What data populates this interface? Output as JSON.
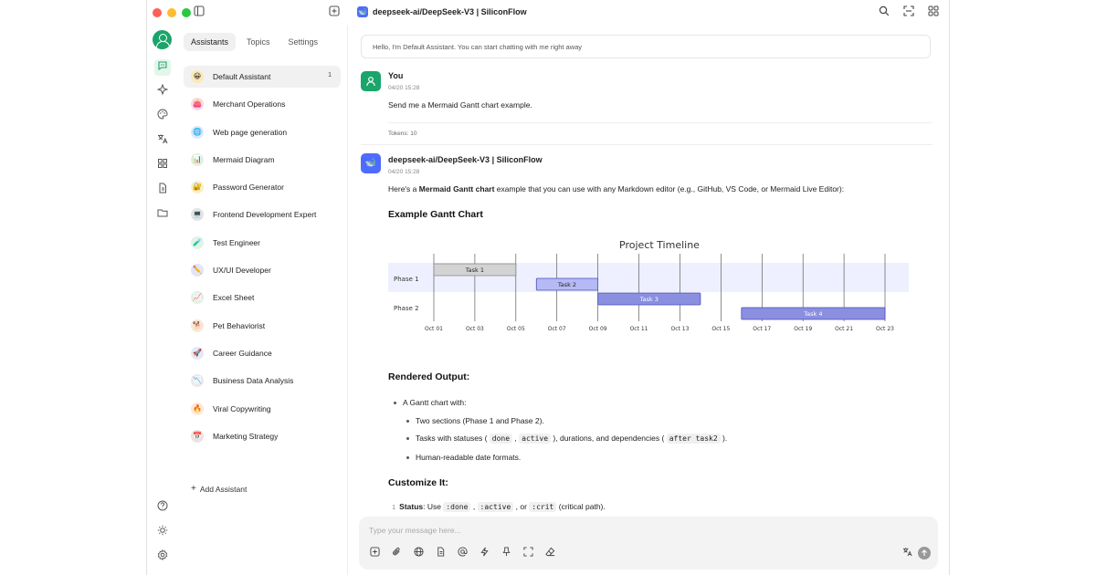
{
  "window": {
    "model_title": "deepseek-ai/DeepSeek-V3 | SiliconFlow"
  },
  "panel": {
    "tabs": [
      "Assistants",
      "Topics",
      "Settings"
    ],
    "assistants": [
      {
        "label": "Default Assistant",
        "emoji": "😀",
        "count": "1",
        "bg": "#fde9b8"
      },
      {
        "label": "Merchant Operations",
        "emoji": "👛",
        "bg": "#fbd7e6"
      },
      {
        "label": "Web page generation",
        "emoji": "🌐",
        "bg": "#dbe9fb"
      },
      {
        "label": "Mermaid Diagram",
        "emoji": "📊",
        "bg": "#e3f3d7"
      },
      {
        "label": "Password Generator",
        "emoji": "🔐",
        "bg": "#fbefc4"
      },
      {
        "label": "Frontend Development Expert",
        "emoji": "💻",
        "bg": "#e4e4e4"
      },
      {
        "label": "Test Engineer",
        "emoji": "🧪",
        "bg": "#e2f4e4"
      },
      {
        "label": "UX/UI Developer",
        "emoji": "✏️",
        "bg": "#e2e4f7"
      },
      {
        "label": "Excel Sheet",
        "emoji": "📈",
        "bg": "#e2f1e3"
      },
      {
        "label": "Pet Behaviorist",
        "emoji": "🐕",
        "bg": "#f8e7d8"
      },
      {
        "label": "Career Guidance",
        "emoji": "🚀",
        "bg": "#e6e8f6"
      },
      {
        "label": "Business Data Analysis",
        "emoji": "📉",
        "bg": "#efe6ee"
      },
      {
        "label": "Viral Copywriting",
        "emoji": "🔥",
        "bg": "#fde8d6"
      },
      {
        "label": "Marketing Strategy",
        "emoji": "📅",
        "bg": "#ece3e3"
      }
    ],
    "add_assistant": "Add Assistant"
  },
  "chat": {
    "system_message": "Hello, I'm Default Assistant. You can start chatting with me right away",
    "user": {
      "name": "You",
      "time": "04/20 15:28",
      "text": "Send me a Mermaid Gantt chart example.",
      "tokens": "Tokens: 10"
    },
    "assistant": {
      "name": "deepseek-ai/DeepSeek-V3 | SiliconFlow",
      "time": "04/20 15:28",
      "intro_pre": "Here's a ",
      "intro_bold": "Mermaid Gantt chart",
      "intro_post": " example that you can use with any Markdown editor (e.g., GitHub, VS Code, or Mermaid Live Editor):",
      "h_example": "Example Gantt Chart",
      "h_rendered": "Rendered Output:",
      "rendered_items": {
        "a": "A Gantt chart with:",
        "b": "Two sections (Phase 1 and Phase 2).",
        "c_pre": "Tasks with statuses ( ",
        "c_code1": "done",
        "c_mid1": " , ",
        "c_code2": "active",
        "c_mid2": " ), durations, and dependencies ( ",
        "c_code3": "after task2",
        "c_post": " ).",
        "d": "Human-readable date formats."
      },
      "h_customize": "Customize It:",
      "customize_item": {
        "num": "1",
        "bold": "Status",
        "pre": ": Use ",
        "code1": ":done",
        "sep1": " , ",
        "code2": ":active",
        "sep2": " , or ",
        "code3": ":crit",
        "post": " (critical path)."
      }
    },
    "input_placeholder": "Type your message here..."
  },
  "chart_data": {
    "type": "gantt",
    "title": "Project Timeline",
    "sections": [
      "Phase 1",
      "Phase 2"
    ],
    "tick_labels": [
      "Oct 01",
      "Oct 03",
      "Oct 05",
      "Oct 07",
      "Oct 09",
      "Oct 11",
      "Oct 13",
      "Oct 15",
      "Oct 17",
      "Oct 19",
      "Oct 21",
      "Oct 23"
    ],
    "tick_days": [
      1,
      3,
      5,
      7,
      9,
      11,
      13,
      15,
      17,
      19,
      21,
      23
    ],
    "xlim": [
      1,
      23
    ],
    "tasks": [
      {
        "name": "Task 1",
        "section": "Phase 1",
        "start": 1,
        "end": 5,
        "status": "done"
      },
      {
        "name": "Task 2",
        "section": "Phase 1",
        "start": 6,
        "end": 9,
        "status": "active"
      },
      {
        "name": "Task 3",
        "section": "Phase 2",
        "start": 9,
        "end": 14,
        "status": "normal"
      },
      {
        "name": "Task 4",
        "section": "Phase 2",
        "start": 16,
        "end": 23,
        "status": "normal"
      }
    ],
    "colors": {
      "done": "#d3d3d3",
      "active": "#b5b9f5",
      "normal": "#8a8fe0",
      "section1_bg": "#eef0ff"
    }
  }
}
